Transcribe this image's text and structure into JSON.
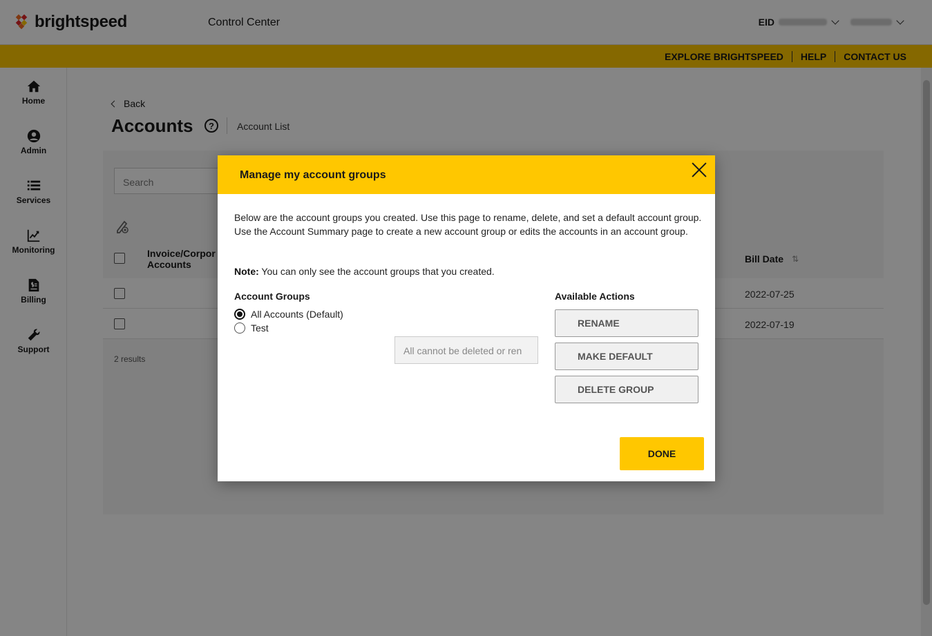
{
  "header": {
    "brand": "brightspeed",
    "app_title": "Control Center",
    "eid_label": "EID",
    "colors": {
      "accent": "#ffc700",
      "logo_orange": "#f26b21",
      "logo_red": "#e0262a",
      "logo_yellow": "#ffc700"
    }
  },
  "top_links": [
    {
      "label": "EXPLORE BRIGHTSPEED"
    },
    {
      "label": "HELP"
    },
    {
      "label": "CONTACT US"
    }
  ],
  "sidebar": {
    "items": [
      {
        "label": "Home",
        "icon": "home-icon"
      },
      {
        "label": "Admin",
        "icon": "user-icon"
      },
      {
        "label": "Services",
        "icon": "list-icon"
      },
      {
        "label": "Monitoring",
        "icon": "chart-icon"
      },
      {
        "label": "Billing",
        "icon": "bill-icon"
      },
      {
        "label": "Support",
        "icon": "wrench-icon"
      }
    ]
  },
  "page": {
    "back_label": "Back",
    "title": "Accounts",
    "help_glyph": "?",
    "breadcrumb": "Account List",
    "search_placeholder": "Search",
    "table": {
      "col_invoice_line1": "Invoice/Corpor",
      "col_invoice_line2": "Accounts",
      "col_bill_date": "Bill Date",
      "sort_glyph": "⇅",
      "rows": [
        {
          "bill_date": "2022-07-25"
        },
        {
          "bill_date": "2022-07-19"
        }
      ]
    },
    "results": "2 results"
  },
  "modal": {
    "title": "Manage my account groups",
    "description": "Below are the account groups you created. Use this page to rename, delete, and set a default account group. Use the Account Summary page to create a new account group or edits the accounts in an account group.",
    "note_label": "Note:",
    "note_text": " You can only see the account groups that you created.",
    "groups_title": "Account Groups",
    "groups": [
      {
        "label": "All Accounts (Default)",
        "selected": true
      },
      {
        "label": "Test",
        "selected": false
      }
    ],
    "rename_input_value": "All cannot be deleted or ren",
    "actions_title": "Available Actions",
    "actions": [
      {
        "label": "RENAME"
      },
      {
        "label": "MAKE DEFAULT"
      },
      {
        "label": "DELETE GROUP"
      }
    ],
    "done_label": "DONE"
  }
}
